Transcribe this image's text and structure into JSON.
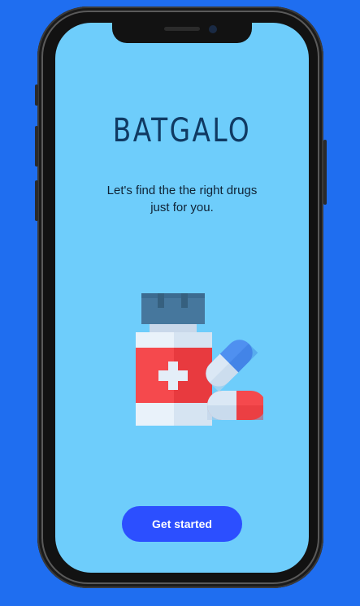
{
  "app": {
    "title": "BATGALO",
    "tagline": "Let's find the the right drugs just for you."
  },
  "illustration": {
    "icon": "medicine-bottle-with-pills"
  },
  "cta": {
    "label": "Get started"
  },
  "colors": {
    "background": "#1f6ef0",
    "screen": "#6ecdfb",
    "title": "#103a63",
    "button": "#2c4fff"
  }
}
